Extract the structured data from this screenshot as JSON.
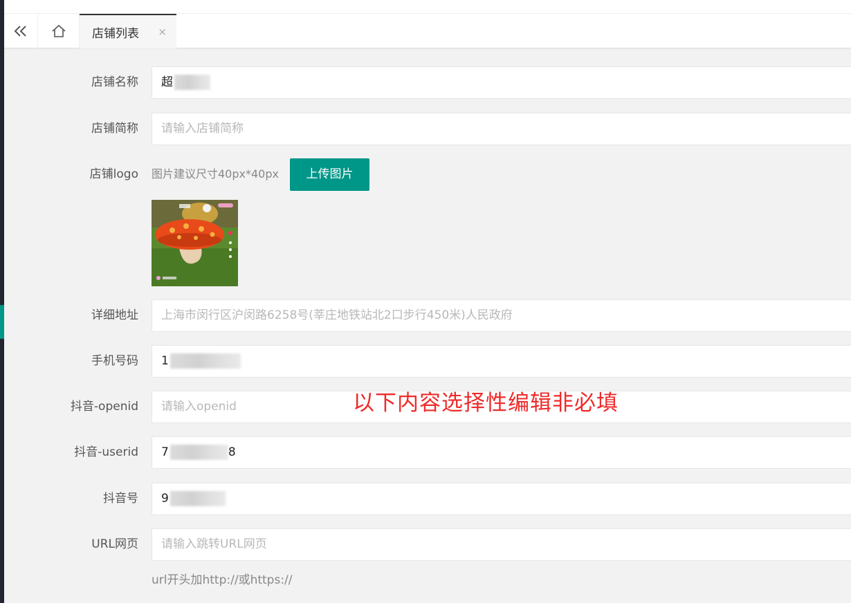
{
  "tabs": {
    "prev_icon": "double-chevron-left-icon",
    "home_icon": "home-icon",
    "active_label": "店铺列表",
    "close_icon": "close-icon",
    "close_glyph": "×"
  },
  "form": {
    "store_name": {
      "label": "店铺名称",
      "value": "超"
    },
    "store_short": {
      "label": "店铺简称",
      "placeholder": "请输入店铺简称"
    },
    "store_logo": {
      "label": "店铺logo",
      "hint": "图片建议尺寸40px*40px",
      "upload_label": "上传图片"
    },
    "address": {
      "label": "详细地址",
      "placeholder": "上海市闵行区沪闵路6258号(莘庄地铁站北2口步行450米)人民政府"
    },
    "phone": {
      "label": "手机号码",
      "value_prefix": "1",
      "value_suffix": ""
    },
    "douyin_openid": {
      "label": "抖音-openid",
      "placeholder": "请输入openid"
    },
    "douyin_userid": {
      "label": "抖音-userid",
      "value_prefix": "7",
      "value_suffix": "8"
    },
    "douyin_no": {
      "label": "抖音号",
      "value_prefix": "9"
    },
    "url": {
      "label": "URL网页",
      "placeholder": "请输入跳转URL网页",
      "hint": "url开头加http://或https://"
    }
  },
  "annotation": "以下内容选择性编辑非必填",
  "colors": {
    "accent": "#009688",
    "annotation": "#ee2a2a",
    "sidebar": "#23262e"
  }
}
